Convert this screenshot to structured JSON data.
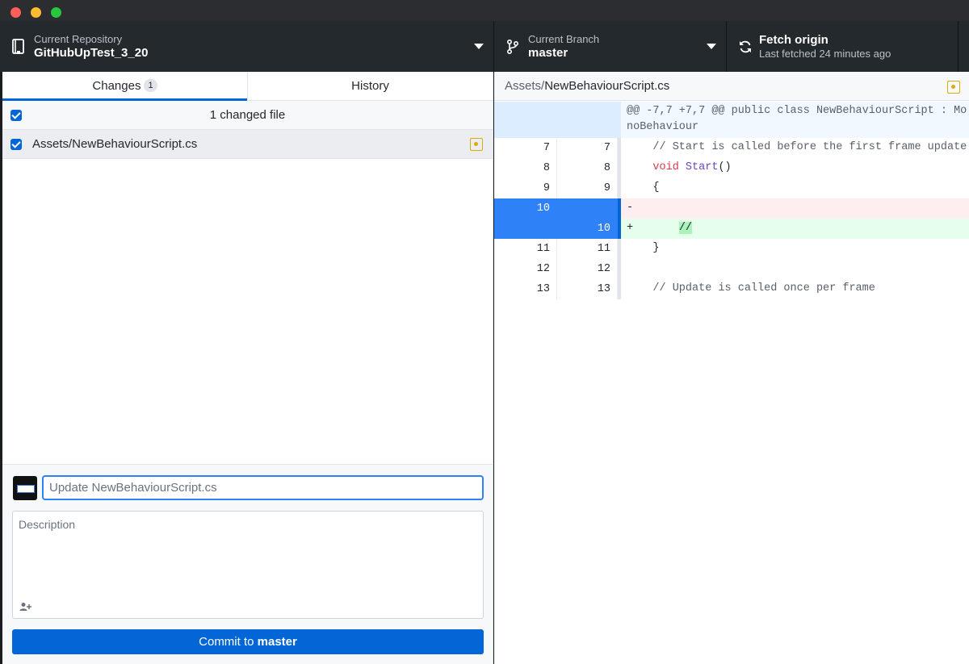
{
  "toolbar": {
    "repo_label": "Current Repository",
    "repo_name": "GitHubUpTest_3_20",
    "branch_label": "Current Branch",
    "branch_name": "master",
    "fetch_title": "Fetch origin",
    "fetch_sub": "Last fetched 24 minutes ago"
  },
  "tabs": {
    "changes_label": "Changes",
    "changes_count": "1",
    "history_label": "History"
  },
  "changes": {
    "header": "1 changed file",
    "files": [
      {
        "path": "Assets/NewBehaviourScript.cs",
        "checked": true,
        "status": "modified"
      }
    ]
  },
  "commit": {
    "summary_placeholder": "Update NewBehaviourScript.cs",
    "description_placeholder": "Description",
    "button_prefix": "Commit to",
    "button_branch": "master"
  },
  "diff": {
    "dir": "Assets/",
    "file": "NewBehaviourScript.cs",
    "hunk": "@@ -7,7 +7,7 @@ public class NewBehaviourScript : MonoBehaviour",
    "lines": [
      {
        "old": "7",
        "new": "7",
        "text": "    // Start is called before the first frame update"
      },
      {
        "old": "8",
        "new": "8",
        "indent": "    ",
        "kw": "void",
        "fn": "Start",
        "rest": "()"
      },
      {
        "old": "9",
        "new": "9",
        "text": "    {"
      },
      {
        "old": "10",
        "new": "",
        "sign": "-",
        "text": ""
      },
      {
        "old": "",
        "new": "10",
        "sign": "+",
        "indent": "       ",
        "text": "//"
      },
      {
        "old": "11",
        "new": "11",
        "text": "    }"
      },
      {
        "old": "12",
        "new": "12",
        "text": ""
      },
      {
        "old": "13",
        "new": "13",
        "text": "    // Update is called once per frame"
      }
    ]
  },
  "colors": {
    "accent": "#0366d6",
    "toolbar_bg": "#24292e",
    "modified": "#dbab09",
    "deleted_bg": "#ffeef0",
    "added_bg": "#e6ffed"
  }
}
